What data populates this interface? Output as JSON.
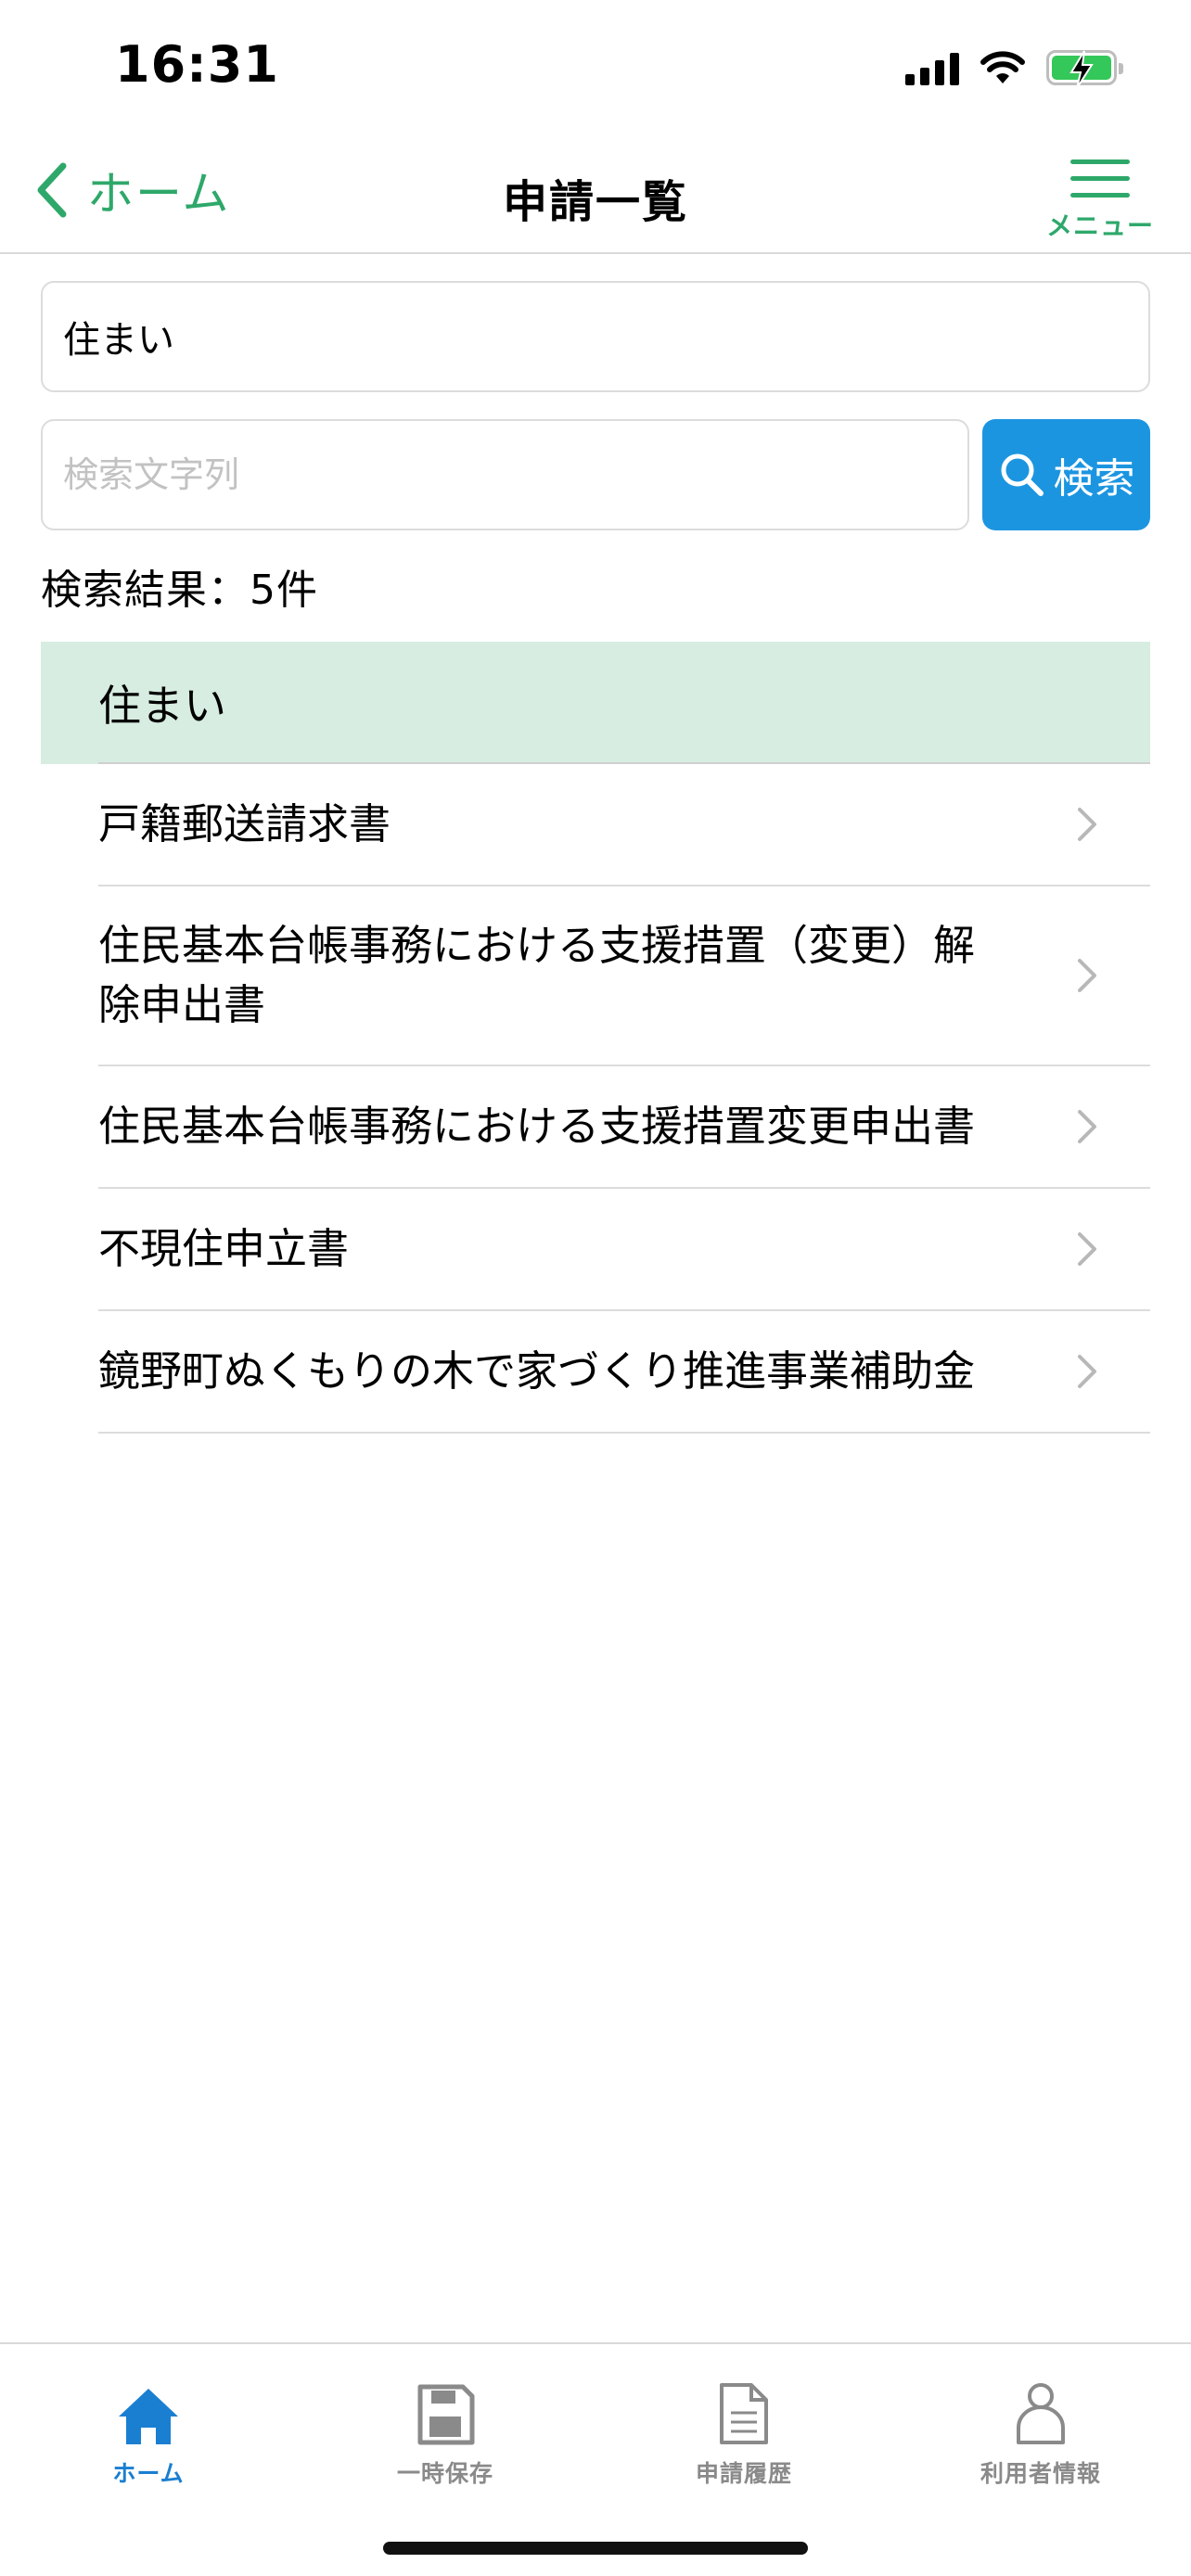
{
  "status_bar": {
    "time": "16:31",
    "icons": [
      "cellular-signal-icon",
      "wifi-icon",
      "battery-charging-icon"
    ]
  },
  "nav": {
    "back_label": "ホーム",
    "title": "申請一覧",
    "menu_label": "メニュー"
  },
  "category_select": {
    "value": "住まい"
  },
  "search": {
    "placeholder": "検索文字列",
    "value": "",
    "button_label": "検索"
  },
  "results": {
    "count_label": "検索結果：5件",
    "group_label": "住まい",
    "items": [
      {
        "label": "戸籍郵送請求書"
      },
      {
        "label": "住民基本台帳事務における支援措置（変更）解除申出書"
      },
      {
        "label": "住民基本台帳事務における支援措置変更申出書"
      },
      {
        "label": "不現住申立書"
      },
      {
        "label": "鏡野町ぬくもりの木で家づくり推進事業補助金"
      }
    ]
  },
  "tab_bar": {
    "tabs": [
      {
        "label": "ホーム",
        "icon": "home-icon",
        "active": true
      },
      {
        "label": "一時保存",
        "icon": "save-icon",
        "active": false
      },
      {
        "label": "申請履歴",
        "icon": "document-icon",
        "active": false
      },
      {
        "label": "利用者情報",
        "icon": "user-icon",
        "active": false
      }
    ]
  },
  "colors": {
    "accent_green": "#2ea86a",
    "search_button_blue": "#1c95e1",
    "group_header_bg": "#d7ede1",
    "active_tab_blue": "#1a7fd1",
    "inactive_tab_gray": "#8a8a8a"
  }
}
